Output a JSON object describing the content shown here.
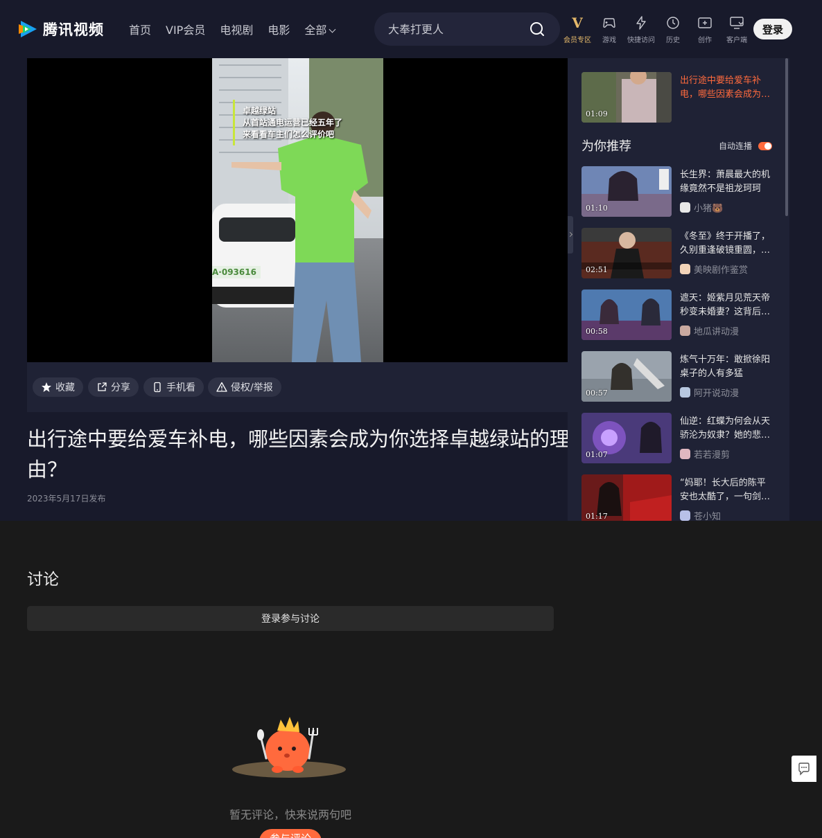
{
  "header": {
    "logo_text": "腾讯视频",
    "nav": [
      "首页",
      "VIP会员",
      "电视剧",
      "电影",
      "全部"
    ],
    "search_placeholder": "大奉打更人",
    "tools": {
      "vip_glyph": "V",
      "vip_label": "会员专区",
      "game_label": "游戏",
      "quick_label": "快捷访问",
      "history_label": "历史",
      "create_label": "创作",
      "client_label": "客户端"
    },
    "login_label": "登录"
  },
  "video": {
    "overlay_lines": [
      "卓越绿站",
      "从首站通电运营已经五年了",
      "来看看车主们怎么评价吧"
    ],
    "plate": "A·093616",
    "actions": {
      "collect": "收藏",
      "share": "分享",
      "mobile": "手机看",
      "report": "侵权/举报"
    },
    "title": "出行途中要给爱车补电，哪些因素会成为你选择卓越绿站的理由？",
    "date": "2023年5月17日发布"
  },
  "sidebar": {
    "current": {
      "title": "出行途中要给爱车补电，哪些因素会成为…",
      "duration": "01:09"
    },
    "heading": "为你推荐",
    "autoplay_label": "自动连播",
    "items": [
      {
        "title": "长生界：萧晨最大的机缘竟然不是祖龙珂珂",
        "author": "小猪🐻",
        "duration": "01:10"
      },
      {
        "title": "《冬至》终于开播了，久别重逢破镜重圆，…",
        "author": "美映剧作鉴赏",
        "duration": "02:51"
      },
      {
        "title": "遮天：姬紫月见荒天帝秒变未婚妻？这背后…",
        "author": "地瓜讲动漫",
        "duration": "00:58"
      },
      {
        "title": "炼气十万年：敢掀徐阳桌子的人有多猛",
        "author": "阿开说动漫",
        "duration": "00:57"
      },
      {
        "title": "仙逆：红蝶为何会从天骄沦为奴隶？她的悲…",
        "author": "若若漫剪",
        "duration": "01:07"
      },
      {
        "title": "“妈耶！长大后的陈平安也太酷了，一句剑…",
        "author": "苍小知",
        "duration": "01:17"
      }
    ]
  },
  "discussion": {
    "heading": "讨论",
    "login_prompt": "登录参与讨论",
    "empty_text": "暂无评论，快来说两句吧",
    "join_label": "参与评论"
  },
  "colors": {
    "accent": "#ff6a3d",
    "vip_gold": "#e5b96a",
    "navy_bg": "#181a2b",
    "panel_bg": "#1f2235",
    "page_bg": "#1a1a1a"
  }
}
